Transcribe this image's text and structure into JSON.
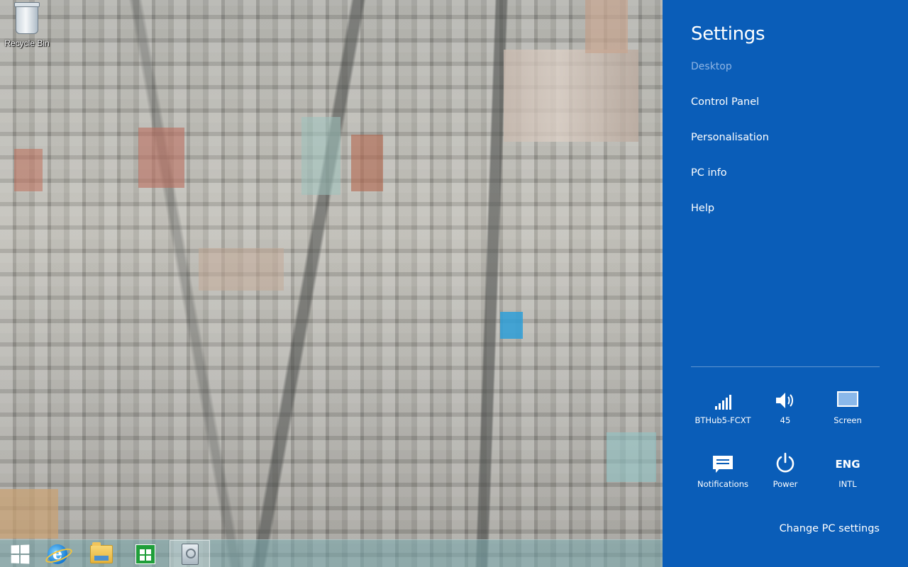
{
  "desktop": {
    "icons": [
      {
        "label": "Recycle Bin",
        "icon": "recycle-bin-icon"
      }
    ]
  },
  "taskbar": {
    "items": [
      {
        "name": "start",
        "icon": "windows-logo-icon"
      },
      {
        "name": "internet-explorer",
        "icon": "internet-explorer-icon"
      },
      {
        "name": "file-explorer",
        "icon": "folder-icon"
      },
      {
        "name": "store",
        "icon": "store-icon"
      },
      {
        "name": "pc-settings",
        "icon": "settings-app-icon",
        "active": true
      }
    ]
  },
  "charm": {
    "title": "Settings",
    "subtitle": "Desktop",
    "menu": [
      {
        "label": "Control Panel"
      },
      {
        "label": "Personalisation"
      },
      {
        "label": "PC info"
      },
      {
        "label": "Help"
      }
    ],
    "quick_settings": [
      {
        "label": "BTHub5-FCXT",
        "icon": "wifi-signal-icon"
      },
      {
        "label": "45",
        "icon": "volume-icon"
      },
      {
        "label": "Screen",
        "icon": "screen-icon"
      },
      {
        "label": "Notifications",
        "icon": "notifications-icon"
      },
      {
        "label": "Power",
        "icon": "power-icon"
      },
      {
        "label": "INTL",
        "icon": "keyboard-language-icon",
        "badge": "ENG"
      }
    ],
    "change_pc_settings": "Change PC settings"
  },
  "colors": {
    "charm_bg": "#0a5db8",
    "charm_subtitle": "#8fb5e4",
    "taskbar": "#78aaaf"
  }
}
